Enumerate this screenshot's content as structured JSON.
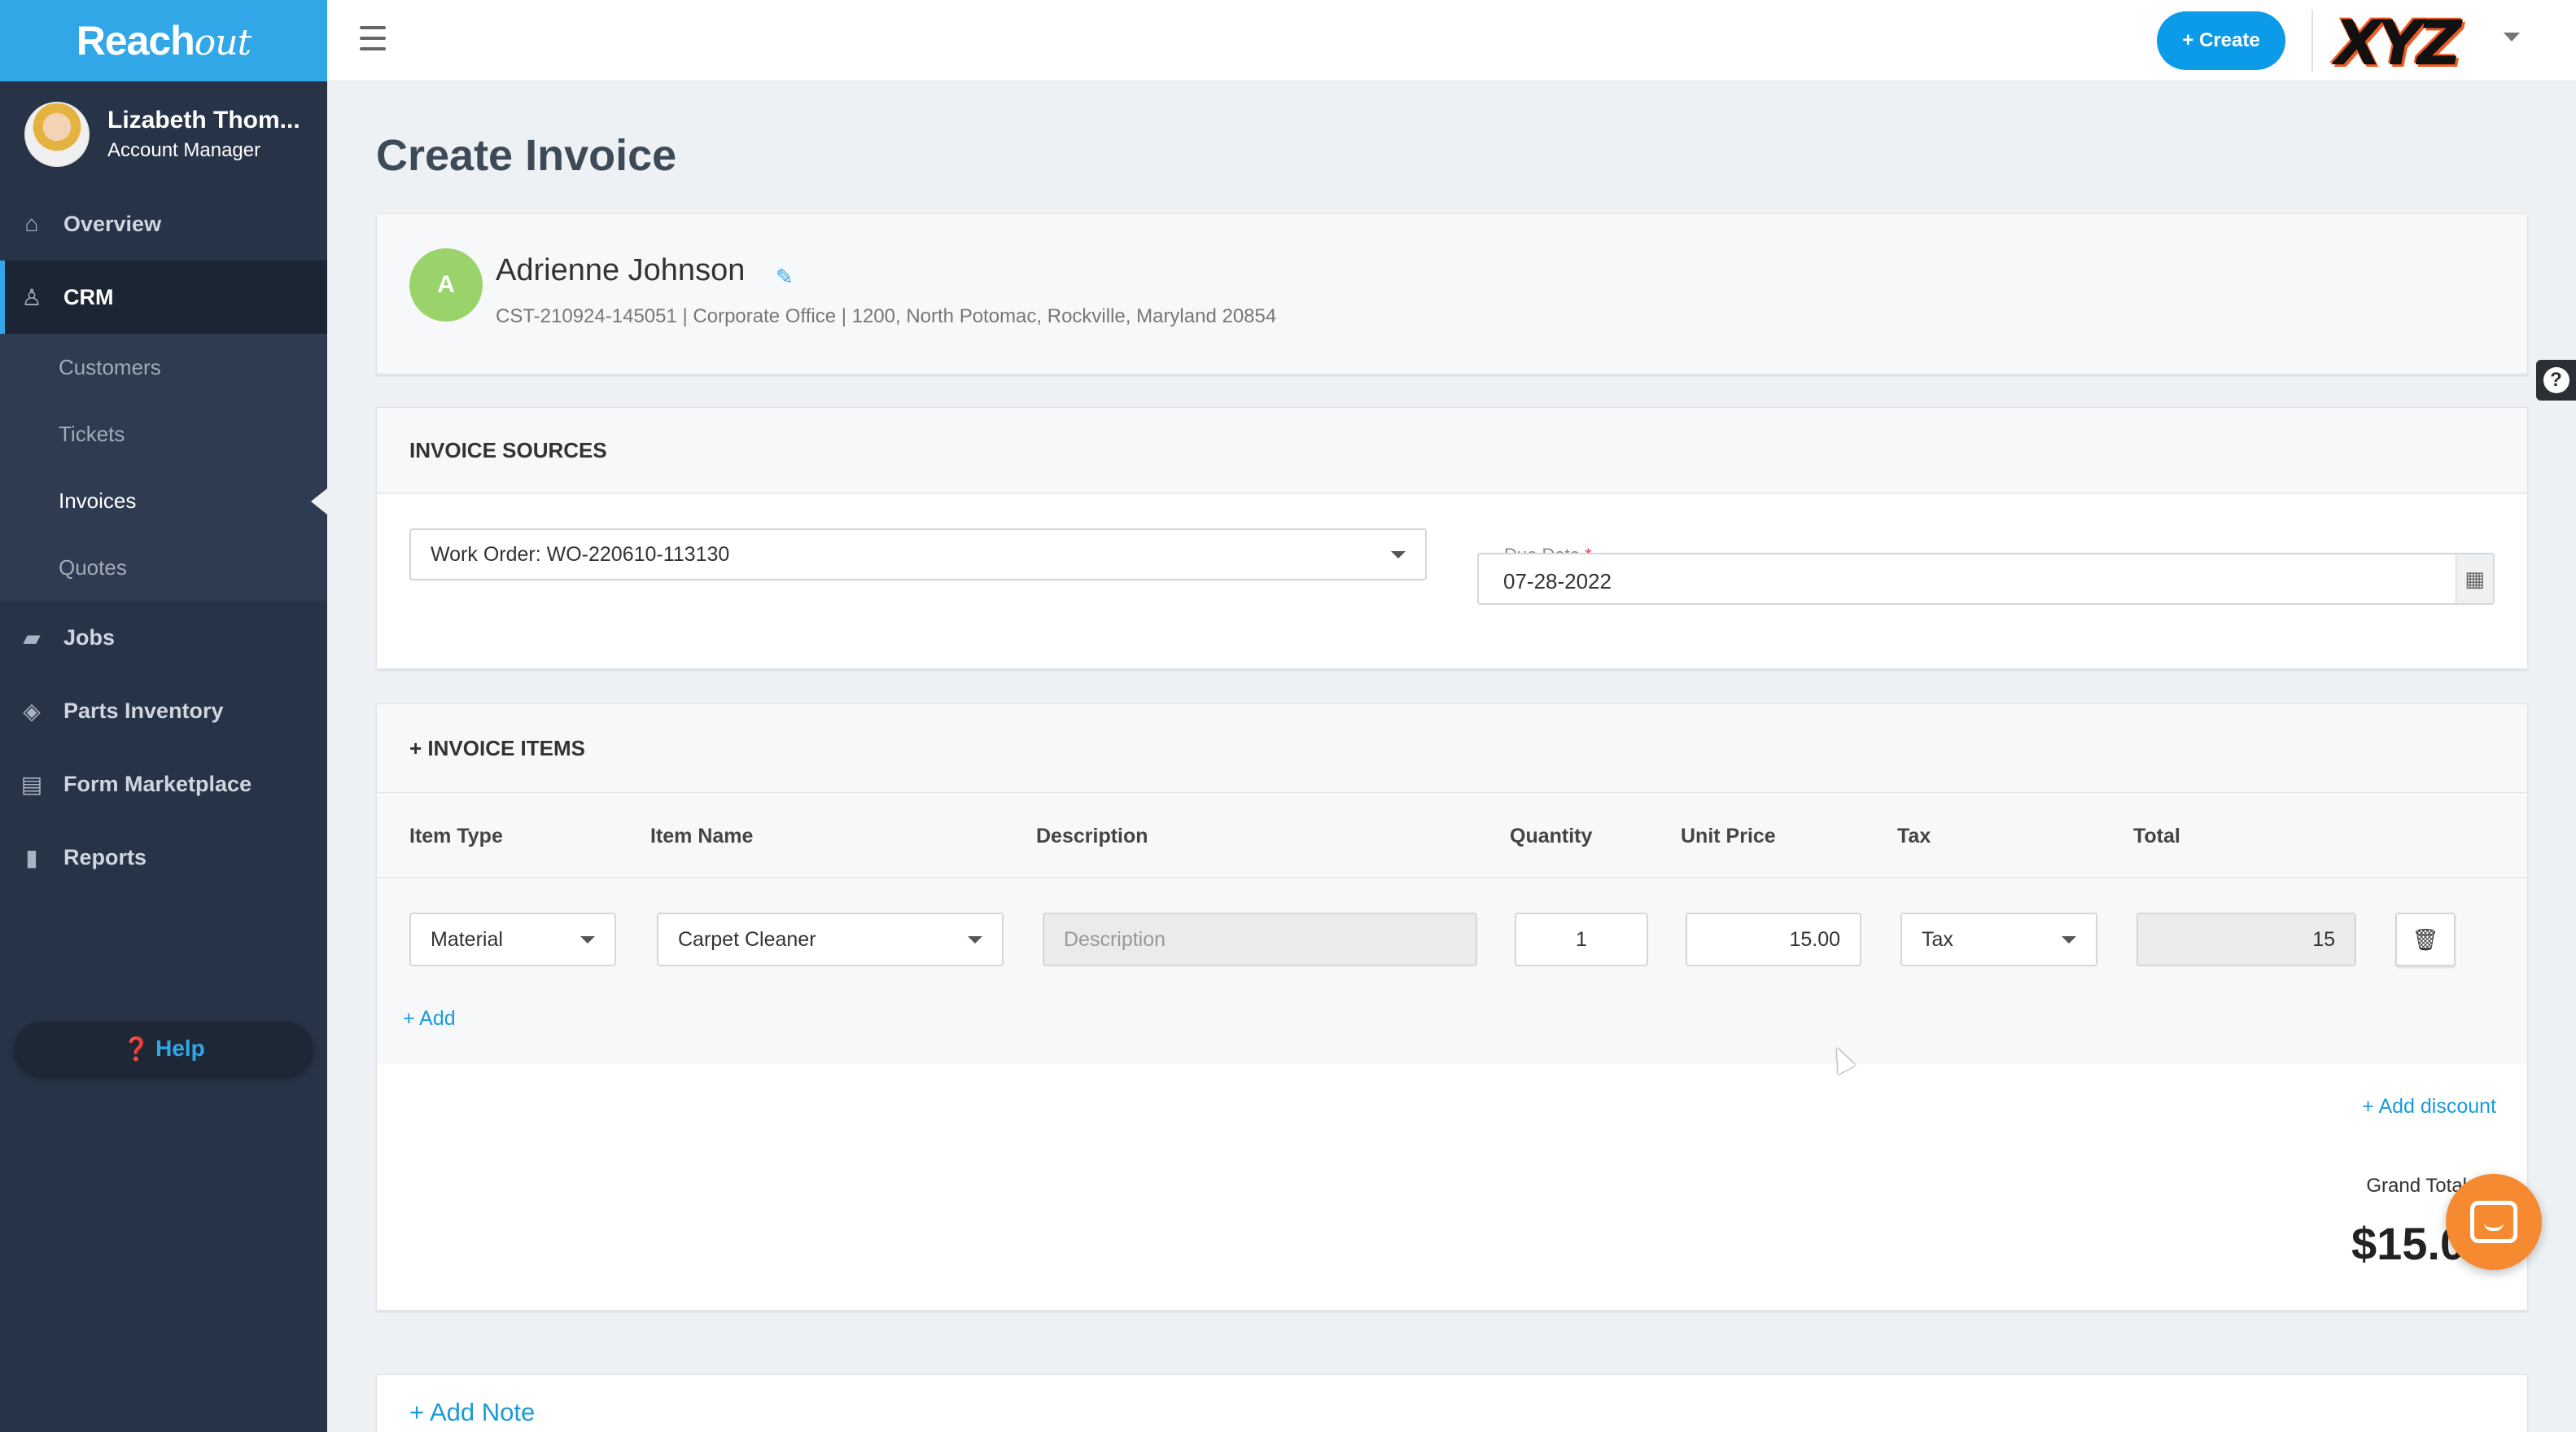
{
  "app": {
    "logo_main": "Reach",
    "logo_script": "out"
  },
  "user": {
    "name": "Lizabeth Thom...",
    "role": "Account Manager"
  },
  "sidebar": {
    "items": [
      {
        "label": "Overview",
        "icon": "home-icon"
      },
      {
        "label": "CRM",
        "icon": "person-icon",
        "active": true
      },
      {
        "label": "Jobs",
        "icon": "briefcase-icon"
      },
      {
        "label": "Parts Inventory",
        "icon": "box-icon"
      },
      {
        "label": "Form Marketplace",
        "icon": "document-icon"
      },
      {
        "label": "Reports",
        "icon": "bar-chart-icon"
      }
    ],
    "crm_sub": [
      {
        "label": "Customers"
      },
      {
        "label": "Tickets"
      },
      {
        "label": "Invoices",
        "active": true
      },
      {
        "label": "Quotes"
      }
    ],
    "help_label": "Help"
  },
  "topbar": {
    "create_label": "+ Create",
    "brand": "XYZ"
  },
  "page": {
    "title": "Create Invoice"
  },
  "customer": {
    "initial": "A",
    "name": "Adrienne Johnson",
    "details": "CST-210924-145051 | Corporate Office | 1200, North Potomac, Rockville, Maryland 20854"
  },
  "sources": {
    "header": "INVOICE SOURCES",
    "work_order": "Work Order: WO-220610-113130",
    "due_label": "Due Date",
    "due_required": "*",
    "due_value": "07-28-2022"
  },
  "items": {
    "header": "+ INVOICE ITEMS",
    "columns": [
      "Item Type",
      "Item Name",
      "Description",
      "Quantity",
      "Unit Price",
      "Tax",
      "Total"
    ],
    "rows": [
      {
        "type": "Material",
        "name": "Carpet Cleaner",
        "description_placeholder": "Description",
        "quantity": "1",
        "unit_price": "15.00",
        "tax": "Tax",
        "total": "15"
      }
    ],
    "add_label": "+ Add",
    "add_discount": "+ Add discount",
    "grand_total_label": "Grand Total",
    "grand_total_value": "$15.00"
  },
  "note": {
    "add_label": "+ Add Note"
  },
  "colors": {
    "accent": "#31a7e7",
    "sidebar": "#273346",
    "chat": "#f58a30"
  }
}
